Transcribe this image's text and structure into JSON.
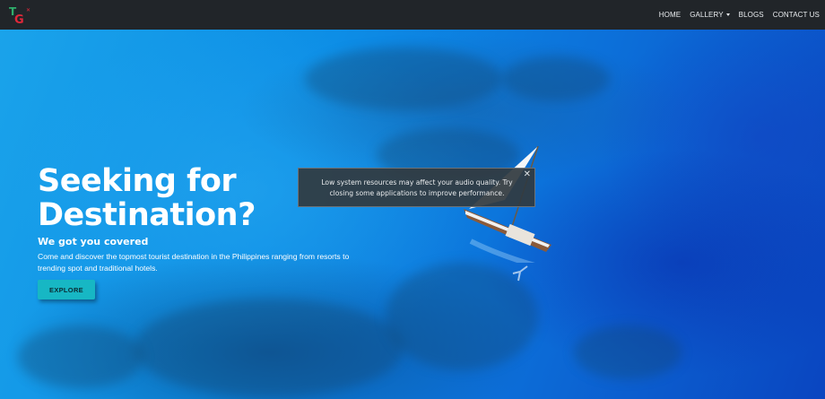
{
  "navbar": {
    "logo_letters": "TG",
    "links": [
      {
        "label": "HOME"
      },
      {
        "label": "GALLERY",
        "has_dropdown": true
      },
      {
        "label": "BLOGS"
      },
      {
        "label": "CONTACT US"
      }
    ]
  },
  "hero": {
    "title_line1": "Seeking for",
    "title_line2": "Destination?",
    "subtitle": "We got you covered",
    "description": "Come and discover the topmost tourist destination in the Philippines ranging from resorts to trending spot and traditional hotels.",
    "button_label": "EXPLORE"
  },
  "toast": {
    "message": "Low system resources may affect your audio quality. Try closing some applications to improve performance.",
    "close_symbol": "✕"
  },
  "colors": {
    "navbar_bg": "#212529",
    "accent_button": "#17b7c4",
    "ocean": "#0d8ee6"
  }
}
